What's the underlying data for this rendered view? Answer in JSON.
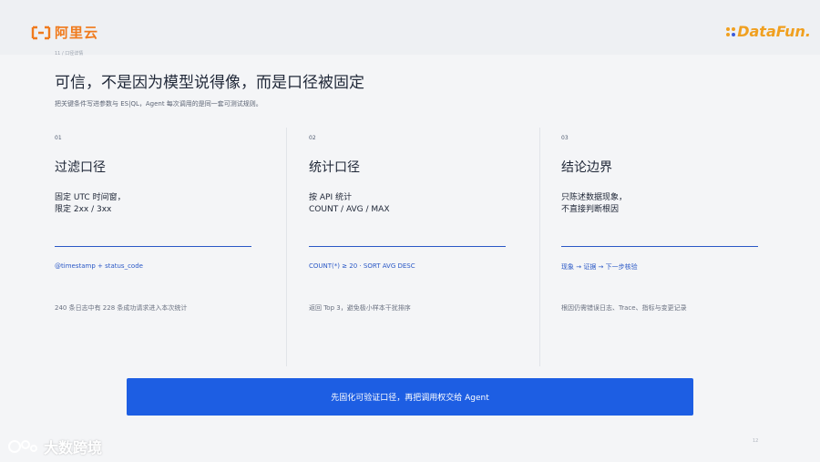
{
  "header": {
    "aliyun_logo_text": "阿里云",
    "datafun_logo_text": "DataFun.",
    "breadcrumb": "11 / 口径详情"
  },
  "main": {
    "title": "可信，不是因为模型说得像，而是口径被固定",
    "subtitle": "把关键条件写进参数与 ES|QL，Agent 每次调用的是同一套可测试规则。",
    "columns": [
      {
        "num": "01",
        "heading": "过滤口径",
        "body": "固定 UTC 时间窗，\n限定 2xx / 3xx",
        "key": "@timestamp + status_code",
        "note": "240 条日志中有 228 条成功请求进入本次统计"
      },
      {
        "num": "02",
        "heading": "统计口径",
        "body": "按 API 统计\nCOUNT / AVG / MAX",
        "key": "COUNT(*) ≥ 20 · SORT AVG DESC",
        "note": "返回 Top 3，避免极小样本干扰排序"
      },
      {
        "num": "03",
        "heading": "结论边界",
        "body": "只陈述数据现象，\n不直接判断根因",
        "key": "现象 → 证据 → 下一步核验",
        "note": "根因仍需错误日志、Trace、指标与变更记录"
      }
    ],
    "cta_label": "先固化可验证口径，再把调用权交给 Agent"
  },
  "footer": {
    "page_number": "12",
    "watermark_text": "大数跨境"
  },
  "colors": {
    "accent": "#1d5ee3",
    "brand_orange": "#f07a1c",
    "brand_yellow": "#f0a020"
  }
}
